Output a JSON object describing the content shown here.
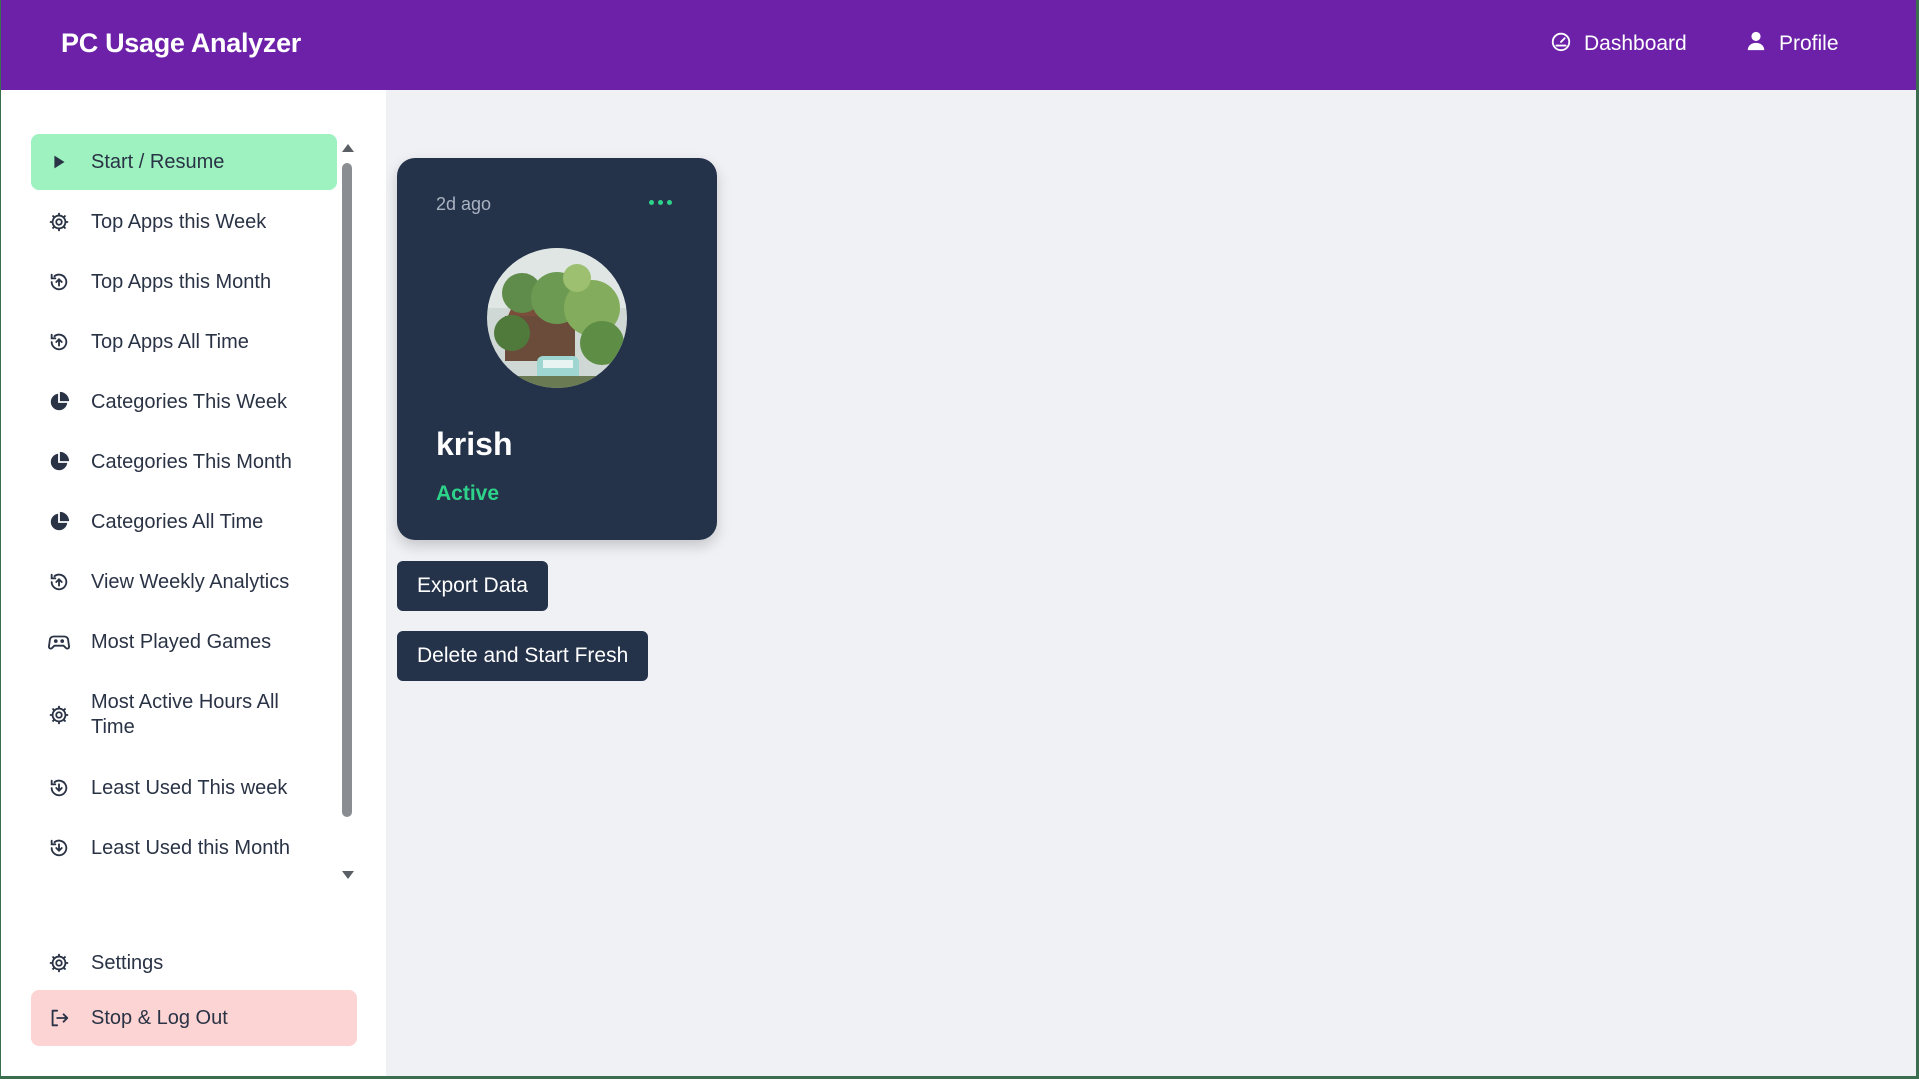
{
  "header": {
    "title": "PC Usage Analyzer",
    "nav": [
      {
        "label": "Dashboard",
        "icon": "gauge-icon"
      },
      {
        "label": "Profile",
        "icon": "user-icon"
      }
    ]
  },
  "sidebar": {
    "items": [
      {
        "label": "Start / Resume",
        "icon": "play-icon",
        "active": true
      },
      {
        "label": "Top Apps this Week",
        "icon": "gear-icon"
      },
      {
        "label": "Top Apps this Month",
        "icon": "history-up-icon"
      },
      {
        "label": "Top Apps All Time",
        "icon": "history-up-icon"
      },
      {
        "label": "Categories This Week",
        "icon": "pie-chart-icon"
      },
      {
        "label": "Categories This Month",
        "icon": "pie-chart-icon"
      },
      {
        "label": "Categories All Time",
        "icon": "pie-chart-icon"
      },
      {
        "label": "View Weekly Analytics",
        "icon": "history-up-icon"
      },
      {
        "label": "Most Played Games",
        "icon": "gamepad-icon"
      },
      {
        "label": "Most Active Hours All Time",
        "icon": "gear-icon"
      },
      {
        "label": "Least Used This week",
        "icon": "history-down-icon"
      },
      {
        "label": "Least Used this Month",
        "icon": "history-down-icon"
      }
    ],
    "settings_label": "Settings",
    "logout_label": "Stop & Log Out"
  },
  "profile_card": {
    "time_ago": "2d ago",
    "name": "krish",
    "status": "Active"
  },
  "actions": {
    "export_label": "Export Data",
    "delete_label": "Delete and Start Fresh"
  },
  "colors": {
    "header": "#6c21a8",
    "active_item": "#9df2c0",
    "logout_item": "#fdd4d4",
    "card": "#24324a",
    "status_green": "#2ed38a"
  }
}
